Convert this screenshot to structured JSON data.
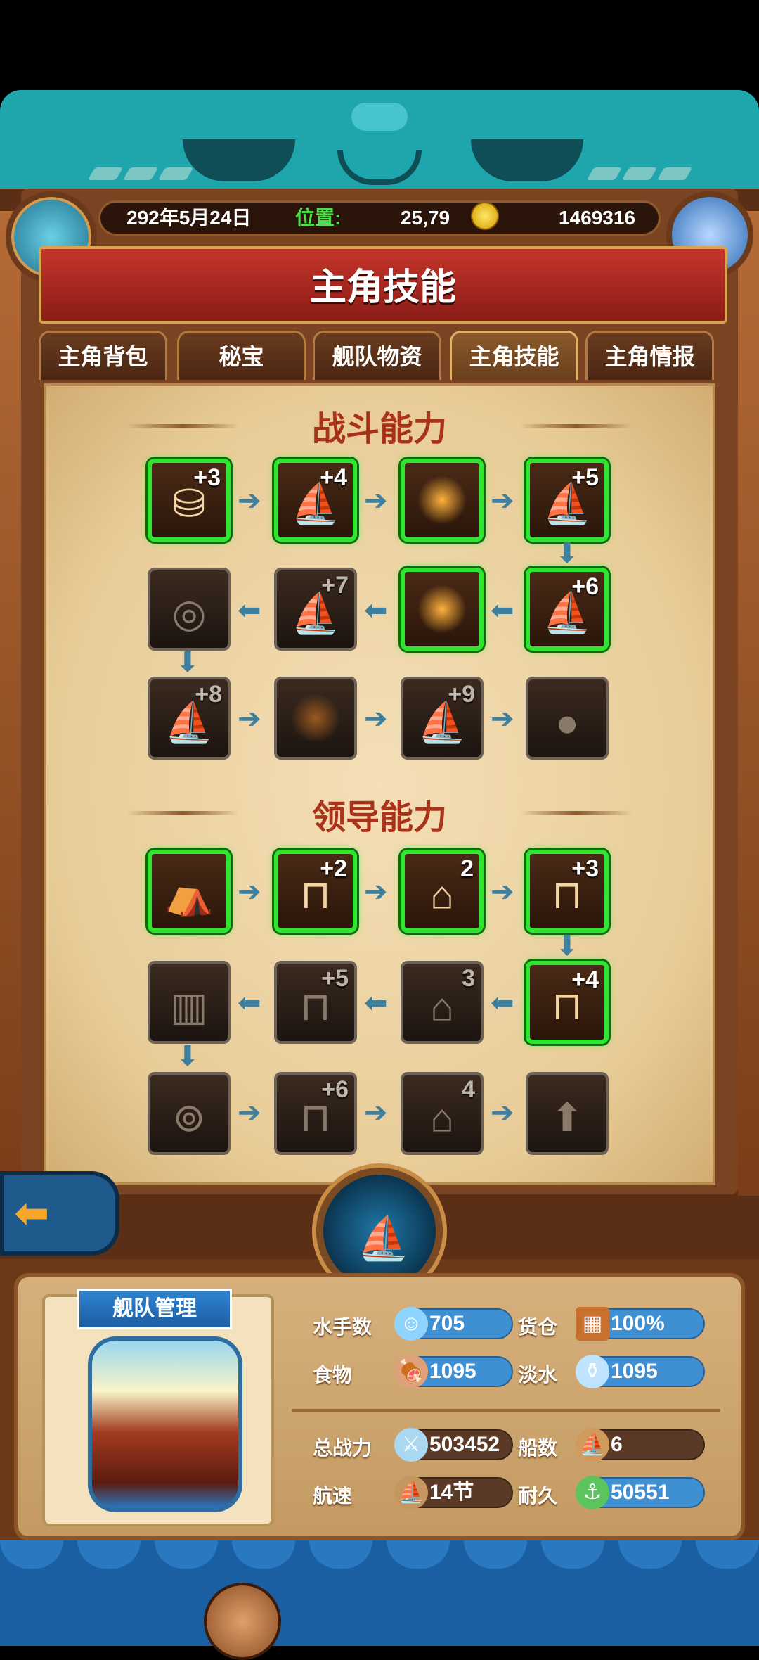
{
  "header": {
    "date": "292年5月24日",
    "position_label": "位置:",
    "position_value": "25,79",
    "gold": "1469316",
    "page_title": "主角技能"
  },
  "tabs": [
    {
      "label": "主角背包",
      "active": false
    },
    {
      "label": "秘宝",
      "active": false
    },
    {
      "label": "舰队物资",
      "active": false
    },
    {
      "label": "主角技能",
      "active": true
    },
    {
      "label": "主角情报",
      "active": false
    }
  ],
  "combat": {
    "title": "战斗能力",
    "rows": [
      [
        {
          "lvl": "+3",
          "on": true,
          "icon": "barrels-icon"
        },
        {
          "lvl": "+4",
          "on": true,
          "icon": "sails-icon"
        },
        {
          "lvl": "",
          "on": true,
          "icon": "formation-icon"
        },
        {
          "lvl": "+5",
          "on": true,
          "icon": "fleet-icon"
        }
      ],
      [
        {
          "lvl": "",
          "on": false,
          "icon": "cannon-icon"
        },
        {
          "lvl": "+7",
          "on": false,
          "icon": "fleet-icon"
        },
        {
          "lvl": "",
          "on": true,
          "icon": "formation-icon"
        },
        {
          "lvl": "+6",
          "on": true,
          "icon": "fleet-icon"
        }
      ],
      [
        {
          "lvl": "+8",
          "on": false,
          "icon": "fleet-icon"
        },
        {
          "lvl": "",
          "on": false,
          "icon": "formation-icon"
        },
        {
          "lvl": "+9",
          "on": false,
          "icon": "fleet-icon"
        },
        {
          "lvl": "",
          "on": false,
          "icon": "cannonball-icon"
        }
      ]
    ]
  },
  "leadership": {
    "title": "领导能力",
    "rows": [
      [
        {
          "lvl": "",
          "on": true,
          "icon": "tent-icon"
        },
        {
          "lvl": "+2",
          "on": true,
          "icon": "dock-icon"
        },
        {
          "lvl": "2",
          "on": true,
          "icon": "building-upgrade-icon"
        },
        {
          "lvl": "+3",
          "on": true,
          "icon": "dock-icon"
        }
      ],
      [
        {
          "lvl": "",
          "on": false,
          "icon": "fortress-icon"
        },
        {
          "lvl": "+5",
          "on": false,
          "icon": "dock-icon"
        },
        {
          "lvl": "3",
          "on": false,
          "icon": "building-upgrade-icon"
        },
        {
          "lvl": "+4",
          "on": true,
          "icon": "dock-icon"
        }
      ],
      [
        {
          "lvl": "",
          "on": false,
          "icon": "wheel-icon"
        },
        {
          "lvl": "+6",
          "on": false,
          "icon": "dock-icon"
        },
        {
          "lvl": "4",
          "on": false,
          "icon": "building-upgrade-icon"
        },
        {
          "lvl": "",
          "on": false,
          "icon": "coin-upgrade-icon"
        }
      ]
    ]
  },
  "fleet": {
    "title": "舰队管理",
    "sailors_label": "水手数",
    "sailors": "705",
    "cargo_label": "货仓",
    "cargo": "100%",
    "food_label": "食物",
    "food": "1095",
    "water_label": "淡水",
    "water": "1095",
    "power_label": "总战力",
    "power": "503452",
    "ships_label": "船数",
    "ships": "6",
    "speed_label": "航速",
    "speed": "14节",
    "durability_label": "耐久",
    "durability": "50551"
  },
  "colors": {
    "active_border": "#2ee62e",
    "title_red": "#a9331a",
    "arrow": "#3f7f9e",
    "pill_blue": "#3f8fd3"
  }
}
